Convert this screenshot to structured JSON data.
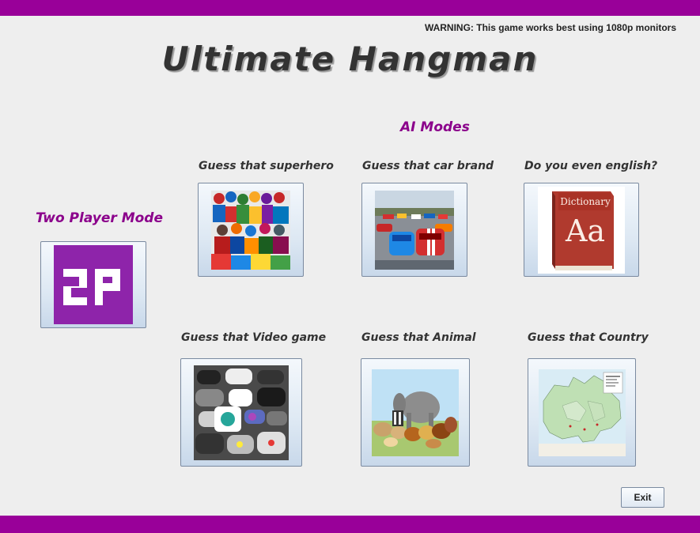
{
  "warning": "WARNING: This game works best using 1080p monitors",
  "title": "Ultimate Hangman",
  "two_player": {
    "label": "Two Player Mode",
    "icon_text": "2P"
  },
  "ai_modes": {
    "label": "AI Modes",
    "modes": [
      {
        "label": "Guess that superhero",
        "icon": "superheroes-image"
      },
      {
        "label": "Guess that car brand",
        "icon": "cars-image"
      },
      {
        "label": "Do you even english?",
        "icon": "dictionary-image"
      },
      {
        "label": "Guess that Video game",
        "icon": "game-controllers-image"
      },
      {
        "label": "Guess that Animal",
        "icon": "animals-image"
      },
      {
        "label": "Guess that Country",
        "icon": "canada-map-image"
      }
    ]
  },
  "dictionary": {
    "title": "Dictionary",
    "text": "Aa"
  },
  "exit_label": "Exit",
  "colors": {
    "bar": "#990099",
    "accent_label": "#8b008b",
    "two_player_icon": "#8e24aa"
  }
}
